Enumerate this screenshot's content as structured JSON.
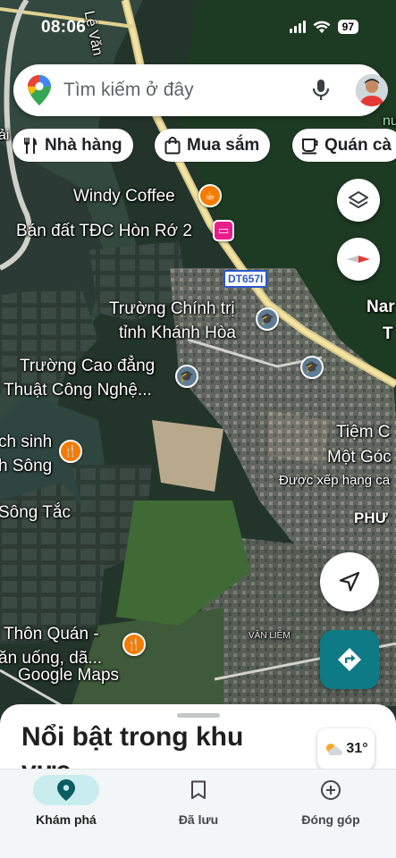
{
  "status_bar": {
    "time": "08:06",
    "battery": "97"
  },
  "search": {
    "placeholder": "Tìm kiếm ở đây"
  },
  "chips": [
    {
      "label": "Nhà hàng",
      "icon": "fork-knife-icon"
    },
    {
      "label": "Mua sắm",
      "icon": "shopping-bag-icon"
    },
    {
      "label": "Quán cà",
      "icon": "coffee-cup-icon"
    }
  ],
  "map": {
    "road_label_vertical": "Lê Văn",
    "road_shield": "DT657I",
    "places": {
      "windy_coffee": "Windy Coffee",
      "ban_dat": "Bán đất TĐC Hòn Rớ 2",
      "truong_chinh_tri_1": "Trường Chính trị",
      "truong_chinh_tri_2": "tỉnh Khánh Hòa",
      "truong_cao_dang_1": "Trường Cao đẳng",
      "truong_cao_dang_2": "Thuật Công Nghệ...",
      "ech_sinh_1": "ch sinh",
      "ech_sinh_2": "h Sông",
      "song_tac": "Sông Tắc",
      "thon_quan_1": "Thôn Quán -",
      "thon_quan_2": "ăn uống, dã...",
      "tiem_1": "Tiệm C",
      "tiem_2": "Một Góc",
      "duoc_xep_hang": "Được xếp hạng ca",
      "phuoc": "PHƯ",
      "nam": "Nar",
      "nam_2": "T",
      "nu": "nu",
      "van_liem": "VĂN LIÊM",
      "left_edge": "ải"
    },
    "watermark": "Google Maps"
  },
  "sheet": {
    "title": "Nổi bật trong khu vực",
    "temperature": "31°"
  },
  "nav": [
    {
      "label": "Khám phá",
      "icon": "explore-pin-icon",
      "active": true
    },
    {
      "label": "Đã lưu",
      "icon": "bookmark-icon",
      "active": false
    },
    {
      "label": "Đóng góp",
      "icon": "add-circle-icon",
      "active": false
    }
  ],
  "colors": {
    "accent": "#0e7a85",
    "food_pin": "#f57c00",
    "school_pin": "#5f7d95",
    "hotel_pin": "#e91e8c"
  }
}
